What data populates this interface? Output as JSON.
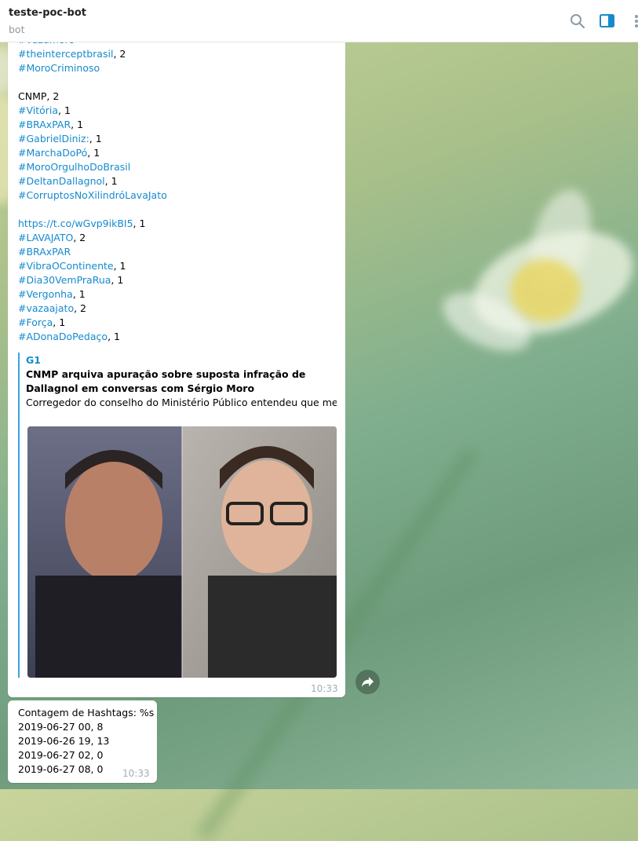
{
  "header": {
    "title": "teste-poc-bot",
    "subtitle": "bot",
    "icons": [
      "search-icon",
      "sidebar-toggle-icon",
      "more-vertical-icon"
    ]
  },
  "message1": {
    "lines": [
      {
        "tag": "#vazamoro",
        "count": ""
      },
      {
        "tag": "#theinterceptbrasil",
        "count": ", 2"
      },
      {
        "tag": "#MoroCriminoso",
        "count": ""
      },
      {
        "tag": "",
        "count": ""
      },
      {
        "tag": "",
        "count": "CNMP, 2"
      },
      {
        "tag": "#Vitória",
        "count": ", 1"
      },
      {
        "tag": "#BRAxPAR",
        "count": ", 1"
      },
      {
        "tag": "#GabrielDiniz:",
        "count": ", 1"
      },
      {
        "tag": "#MarchaDoPó",
        "count": ", 1"
      },
      {
        "tag": "#MoroOrgulhoDoBrasil",
        "count": ""
      },
      {
        "tag": "#DeltanDallagnol",
        "count": ", 1"
      },
      {
        "tag": "#CorruptosNoXilindróLavaJato",
        "count": ""
      },
      {
        "tag": "",
        "count": ""
      },
      {
        "tag": "https://t.co/wGvp9ikBI5",
        "count": ", 1"
      },
      {
        "tag": "#LAVAJATO",
        "count": ", 2"
      },
      {
        "tag": "#BRAxPAR",
        "count": ""
      },
      {
        "tag": "#VibraOContinente",
        "count": ", 1"
      },
      {
        "tag": "#Dia30VemPraRua",
        "count": ", 1"
      },
      {
        "tag": "#Vergonha",
        "count": ", 1"
      },
      {
        "tag": "#vazaajato",
        "count": ", 2"
      },
      {
        "tag": "#Força",
        "count": ", 1"
      },
      {
        "tag": "#ADonaDoPedaço",
        "count": ", 1"
      }
    ],
    "preview": {
      "site": "G1",
      "title": "CNMP arquiva apuração sobre suposta infração de Dallagnol em conversas com Sérgio Moro",
      "description": "Corregedor do conselho do Ministério Público entendeu que mensagens atribuídas aos dois foram obtidas de forma ilícita e ..."
    },
    "time": "10:33"
  },
  "message2": {
    "lines": [
      "Contagem de Hashtags: %s",
      "2019-06-27 00, 8",
      "2019-06-26 19, 13",
      "2019-06-27 02, 0",
      "2019-06-27 08, 0"
    ],
    "time": "10:33"
  },
  "colors": {
    "link": "#168acd",
    "preview_bar": "#37a4e4",
    "time": "#a0acb6",
    "header_icon": "#8e9aa6"
  }
}
